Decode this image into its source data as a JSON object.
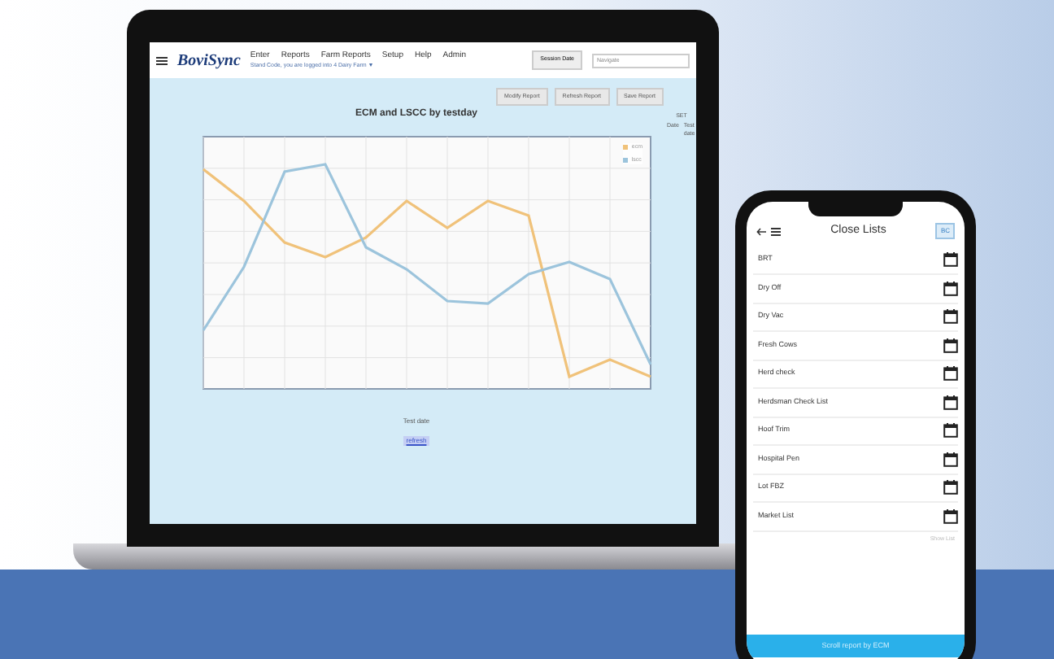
{
  "laptop": {
    "logo": "BoviSync",
    "nav": [
      "Enter",
      "Reports",
      "Farm Reports",
      "Setup",
      "Help",
      "Admin"
    ],
    "subtitle": "Stand Code, you are logged into 4 Dairy Farm ▼",
    "session_button": "Session Date",
    "search": {
      "placeholder": "Navigate"
    },
    "actions": [
      "Modify Report",
      "Refresh Report",
      "Save Report"
    ],
    "chart": {
      "title": "ECM and LSCC by testday",
      "xlabel": "Test date",
      "legend": [
        {
          "name": "ecm",
          "color": "#f0c27a"
        },
        {
          "name": "lscc",
          "color": "#9cc4dc"
        }
      ]
    },
    "link": "refresh",
    "side_table": {
      "title": "SET",
      "columns": [
        "Date",
        "Test date"
      ]
    }
  },
  "phone": {
    "title": "Close Lists",
    "badge": "BC",
    "items": [
      "BRT",
      "Dry Off",
      "Dry Vac",
      "Fresh Cows",
      "Herd check",
      "Herdsman Check List",
      "Hoof Trim",
      "Hospital Pen",
      "Lot FBZ",
      "Market List"
    ],
    "more": "Show List",
    "footer": "Scroll report by ECM"
  }
}
